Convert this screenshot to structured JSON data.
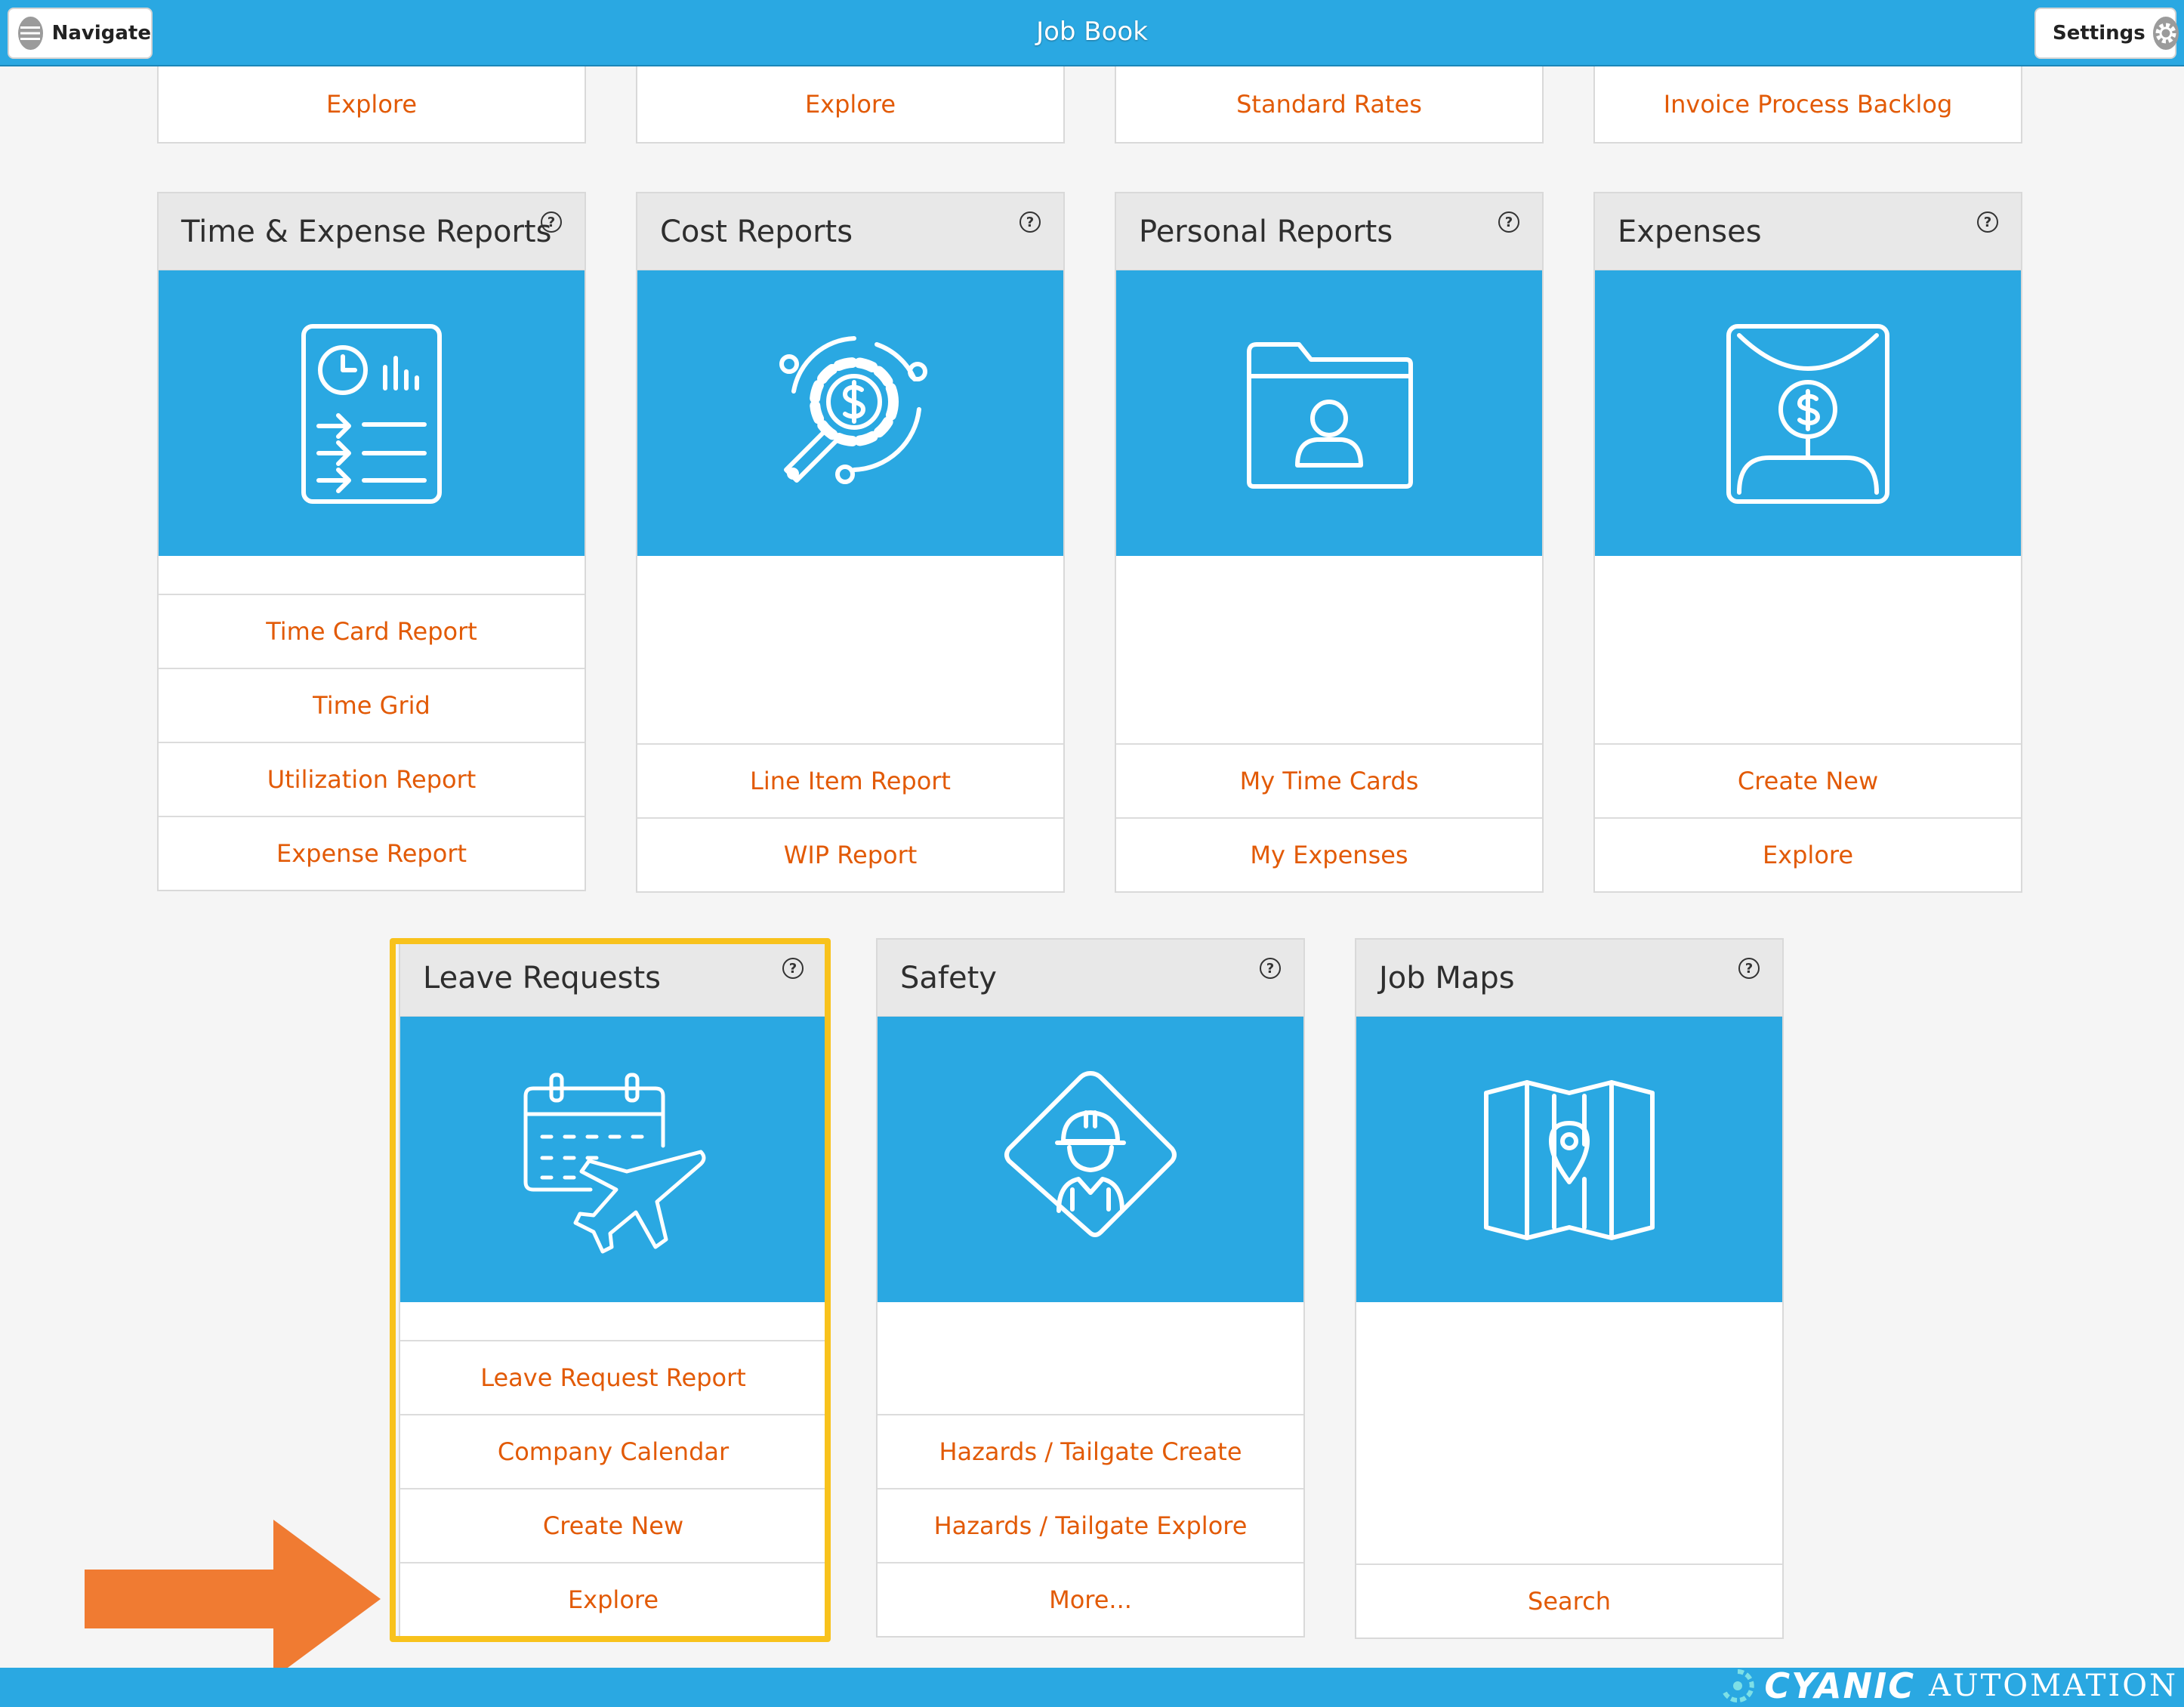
{
  "header": {
    "title": "Job Book",
    "navigate_label": "Navigate",
    "settings_label": "Settings"
  },
  "top_row": [
    "Explore",
    "Explore",
    "Standard Rates",
    "Invoice Process Backlog"
  ],
  "cards": {
    "time_expense": {
      "title": "Time & Expense Reports",
      "links": [
        "Time Card Report",
        "Time Grid",
        "Utilization Report",
        "Expense Report"
      ]
    },
    "cost": {
      "title": "Cost Reports",
      "links": [
        "Line Item Report",
        "WIP Report"
      ]
    },
    "personal": {
      "title": "Personal Reports",
      "links": [
        "My Time Cards",
        "My Expenses"
      ]
    },
    "expenses": {
      "title": "Expenses",
      "links": [
        "Create New",
        "Explore"
      ]
    },
    "leave": {
      "title": "Leave Requests",
      "links": [
        "Leave Request Report",
        "Company Calendar",
        "Create New",
        "Explore"
      ]
    },
    "safety": {
      "title": "Safety",
      "links": [
        "Hazards / Tailgate Create",
        "Hazards / Tailgate Explore",
        "More..."
      ]
    },
    "maps": {
      "title": "Job Maps",
      "links": [
        "Search"
      ]
    }
  },
  "help_glyph": "?",
  "footer": {
    "brand": "CYANIC",
    "brand_suffix": "AUTOMATION"
  },
  "colors": {
    "header_blue": "#2aa8e2",
    "link_orange": "#e25a06",
    "highlight_yellow": "#f8c21c",
    "arrow_orange": "#f07b32"
  },
  "icons": [
    "menu-icon",
    "gear-icon",
    "report-document-icon",
    "cost-gear-magnifier-icon",
    "user-folder-icon",
    "dollar-envelope-icon",
    "calendar-plane-icon",
    "worker-sign-icon",
    "map-pin-icon",
    "help-icon",
    "pointer-arrow-icon",
    "cyanic-logo-icon"
  ]
}
